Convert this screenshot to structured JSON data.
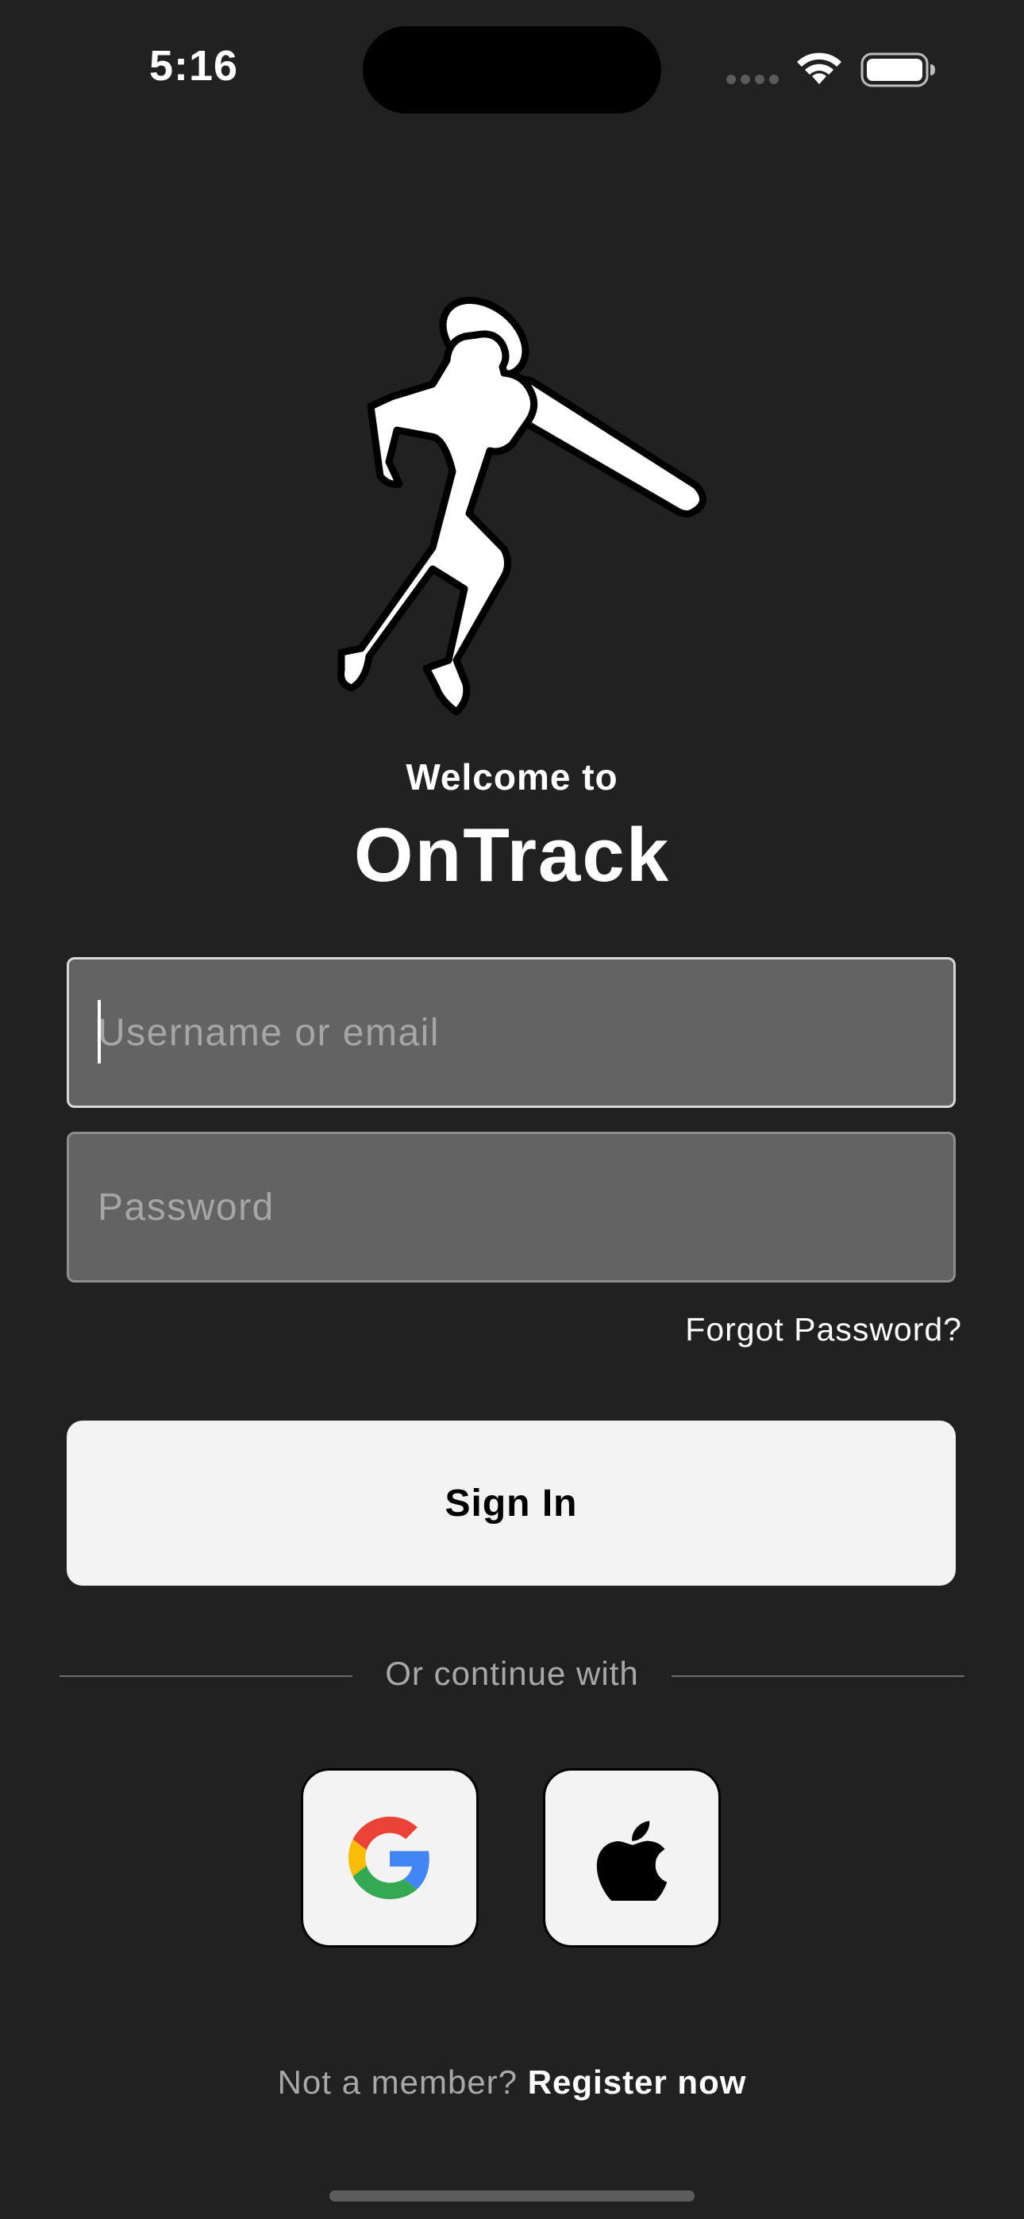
{
  "status_bar": {
    "time": "5:16",
    "icons": [
      "cellular-signal-icon",
      "wifi-icon",
      "battery-icon"
    ]
  },
  "logo": {
    "icon": "runner-with-racket-logo-icon"
  },
  "heading": {
    "welcome": "Welcome to",
    "app_name": "OnTrack"
  },
  "form": {
    "username_placeholder": "Username or email",
    "username_value": "",
    "password_placeholder": "Password",
    "password_value": "",
    "forgot_password": "Forgot Password?",
    "sign_in_label": "Sign In"
  },
  "social": {
    "divider_text": "Or continue with",
    "providers": [
      {
        "name": "Google",
        "icon": "google-icon"
      },
      {
        "name": "Apple",
        "icon": "apple-icon"
      }
    ]
  },
  "footer": {
    "prompt": "Not a member?",
    "register_link": "Register now"
  },
  "colors": {
    "background": "#212121",
    "field_background": "#636363",
    "button_background": "#f3f3f3",
    "muted_text": "#a8a8a8"
  }
}
